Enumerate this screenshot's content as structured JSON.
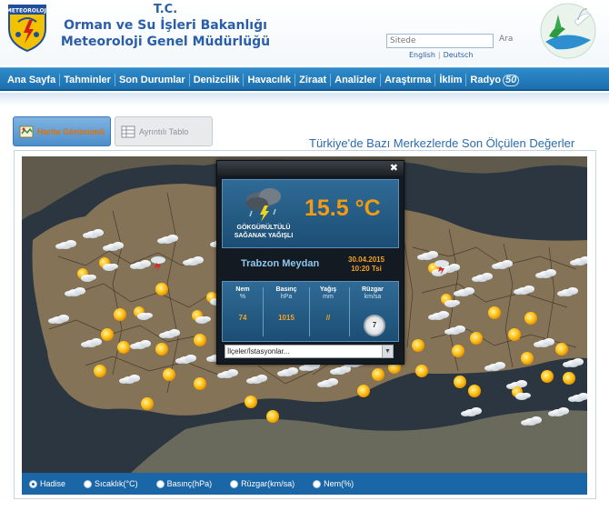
{
  "header": {
    "logo_text": "METEOROLOJİ",
    "title_line1": "T.C.",
    "title_line2": "Orman ve Su İşleri Bakanlığı",
    "title_line3": "Meteoroloji Genel Müdürlüğü",
    "search_placeholder": "Sitede",
    "search_button": "Ara",
    "lang_english": "English",
    "lang_deutsch": "Deutsch"
  },
  "nav": {
    "items": [
      "Ana Sayfa",
      "Tahminler",
      "Son Durumlar",
      "Denizcilik",
      "Havacılık",
      "Ziraat",
      "Analizler",
      "Araştırma",
      "İklim",
      "Radyo"
    ],
    "badge": "50"
  },
  "tabs": {
    "map": "Harita Görünümü",
    "table": "Ayrıntılı Tablo"
  },
  "map_heading": "Türkiye'de Bazı Merkezlerde Son Ölçülen Değerler",
  "popup": {
    "temperature": "15.5 °C",
    "condition_line1": "GÖKGÜRÜLTÜLÜ",
    "condition_line2": "SAĞANAK YAĞIŞLI",
    "station": "Trabzon Meydan",
    "date": "30.04.2015",
    "time": "10:20 Tsi",
    "metrics": [
      {
        "name": "Nem",
        "unit": "%",
        "value": "74"
      },
      {
        "name": "Basınç",
        "unit": "hPa",
        "value": "1015"
      },
      {
        "name": "Yağış",
        "unit": "mm",
        "value": "//"
      },
      {
        "name": "Rüzgar",
        "unit": "km/sa",
        "value": "7"
      }
    ],
    "district_select": "İlçeler/İstasyonlar..."
  },
  "radios": [
    {
      "label": "Hadise",
      "checked": true
    },
    {
      "label": "Sıcaklık(°C)",
      "checked": false
    },
    {
      "label": "Basınç(hPa)",
      "checked": false
    },
    {
      "label": "Rüzgar(km/sa)",
      "checked": false
    },
    {
      "label": "Nem(%)",
      "checked": false
    }
  ],
  "colors": {
    "brand_blue": "#2a5ea8",
    "nav_blue": "#1d6fae",
    "temp_orange": "#f39c12",
    "sea_dark": "#24303a",
    "land": "#7a6a52"
  },
  "icons": {
    "sun": "sun-icon",
    "cloud": "cloud-icon",
    "partly_cloudy": "partly-cloudy-icon",
    "storm": "thunderstorm-icon"
  }
}
